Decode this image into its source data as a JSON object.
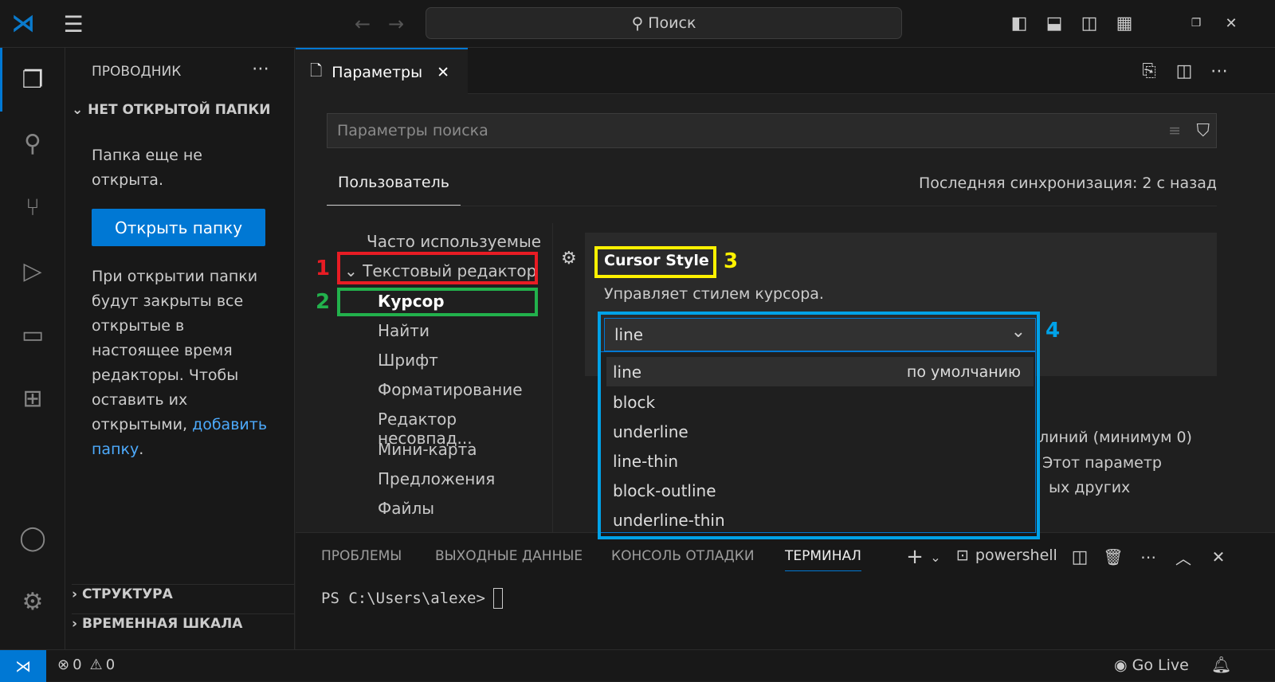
{
  "titlebar": {
    "search": "Поиск"
  },
  "explorer": {
    "title": "ПРОВОДНИК",
    "section": "НЕТ ОТКРЫТОЙ ПАПКИ",
    "no_folder": "Папка еще не открыта.",
    "open_button": "Открыть папку",
    "info": "При открытии папки будут закрыты все открытые в настоящее время редакторы. Чтобы оставить их открытыми,",
    "add_link": "добавить папку",
    "add_suffix": ".",
    "outline": "СТРУКТУРА",
    "timeline": "ВРЕМЕННАЯ ШКАЛА"
  },
  "editor": {
    "tab": "Параметры",
    "search_placeholder": "Параметры поиска",
    "scope_tab": "Пользователь",
    "sync": "Последняя синхронизация: 2 с назад"
  },
  "toc": [
    "Часто используемые",
    "Текстовый редактор",
    "Курсор",
    "Найти",
    "Шрифт",
    "Форматирование",
    "Редактор несовпад...",
    "Мини-карта",
    "Предложения",
    "Файлы"
  ],
  "setting": {
    "title": "Cursor Style",
    "description": "Управляет стилем курсора.",
    "value": "line",
    "default_label": "по умолчанию",
    "options": [
      "line",
      "block",
      "underline",
      "line-thin",
      "block-outline",
      "underline-thin"
    ]
  },
  "background_text": [
    "линий (минимум 0)",
    "Этот параметр",
    "ых других"
  ],
  "annotations": {
    "n1": "1",
    "n2": "2",
    "n3": "3",
    "n4": "4",
    "colors": {
      "n1": "#e81c24",
      "n2": "#22b14c",
      "n3": "#fff200",
      "n4": "#00a2e8"
    }
  },
  "panel": {
    "tabs": [
      "ПРОБЛЕМЫ",
      "ВЫХОДНЫЕ ДАННЫЕ",
      "КОНСОЛЬ ОТЛАДКИ",
      "ТЕРМИНАЛ"
    ],
    "active_tab": "ТЕРМИНАЛ",
    "shell": "powershell",
    "prompt": "PS C:\\Users\\alexe>"
  },
  "statusbar": {
    "errors": "0",
    "warnings": "0",
    "golive": "Go Live"
  },
  "colors": {
    "accent": "#0078d4",
    "link": "#4daafc"
  }
}
